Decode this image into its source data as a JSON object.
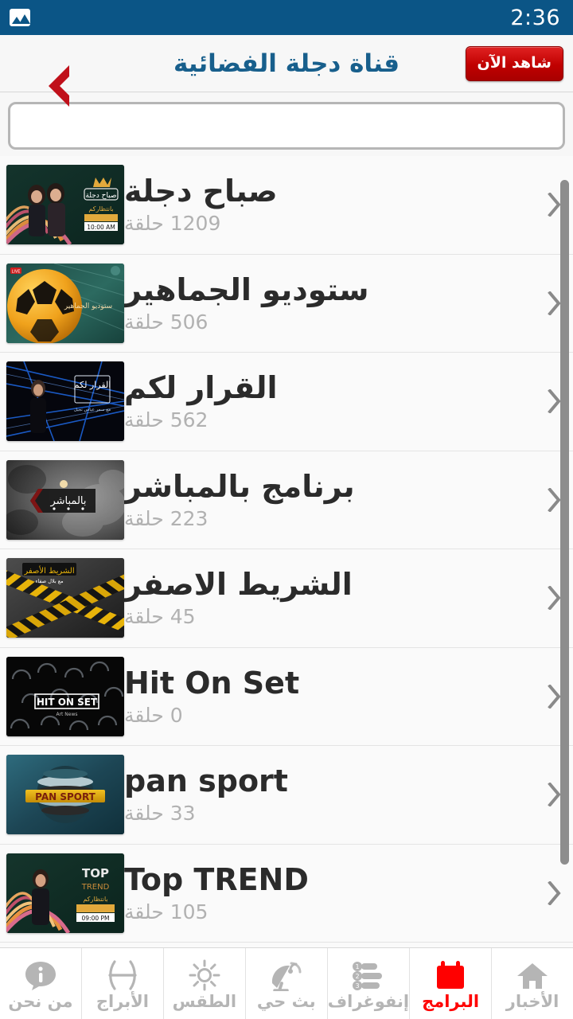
{
  "statusbar": {
    "time": "2:36",
    "left_icon": "image-icon",
    "bg_color": "#0b5586"
  },
  "header": {
    "title": "قناة دجلة الفضائية",
    "title_color": "#185f8c",
    "back_icon": "chevron-back-icon",
    "back_color": "#c0101a",
    "watch_now_label": "شاهد الآن",
    "watch_now_color": "#c00000"
  },
  "search": {
    "value": "",
    "placeholder": ""
  },
  "programs": [
    {
      "title": "صباح دجلة",
      "episodes_text": "1209 حلقة",
      "thumb": "sabah-dijlah-thumb"
    },
    {
      "title": "ستوديو الجماهير",
      "episodes_text": "506 حلقة",
      "thumb": "studio-aljamaheer-thumb"
    },
    {
      "title": "القرار لكم",
      "episodes_text": "562 حلقة",
      "thumb": "alqarar-lakum-thumb"
    },
    {
      "title": "برنامج بالمباشر",
      "episodes_text": "223 حلقة",
      "thumb": "bilmubashir-thumb"
    },
    {
      "title": "الشريط الاصفر",
      "episodes_text": "45 حلقة",
      "thumb": "alshareet-alasfar-thumb"
    },
    {
      "title": "Hit On Set",
      "episodes_text": "0 حلقة",
      "thumb": "hit-on-set-thumb"
    },
    {
      "title": "pan sport",
      "episodes_text": "33 حلقة",
      "thumb": "pan-sport-thumb"
    },
    {
      "title": "Top TREND",
      "episodes_text": "105 حلقة",
      "thumb": "top-trend-thumb"
    }
  ],
  "thumb_texts": {
    "sabah": "صباح دجلة",
    "sabah_sub": "بانتظاركم",
    "sabah_time": "10:00 AM",
    "studio": "ستوديو الجماهير",
    "qarar": "القرار لكم",
    "mubashir": "بالمباشر",
    "asfar": "الشريط الأصفر",
    "asfar_sub": "مع بلال صفاء",
    "hit": "HIT ON SET",
    "hit_sub": "Art News",
    "pan": "PAN SPORT",
    "top": "TOP",
    "top2": "TREND",
    "top_sub": "بانتظاركم",
    "top_time": "09:00 PM"
  },
  "bottomnav": {
    "active_color": "#ff0000",
    "inactive_color": "#b5b5b5",
    "items": [
      {
        "label": "الأخبار",
        "icon": "home-icon",
        "active": false
      },
      {
        "label": "البرامج",
        "icon": "calendar-icon",
        "active": true
      },
      {
        "label": "إنفوغراف",
        "icon": "infographic-bars-icon",
        "active": false
      },
      {
        "label": "بث حي",
        "icon": "satellite-dish-icon",
        "active": false
      },
      {
        "label": "الطقس",
        "icon": "sun-icon",
        "active": false
      },
      {
        "label": "الأبراج",
        "icon": "pisces-zodiac-icon",
        "active": false
      },
      {
        "label": "من نحن",
        "icon": "info-bubble-icon",
        "active": false
      }
    ]
  }
}
